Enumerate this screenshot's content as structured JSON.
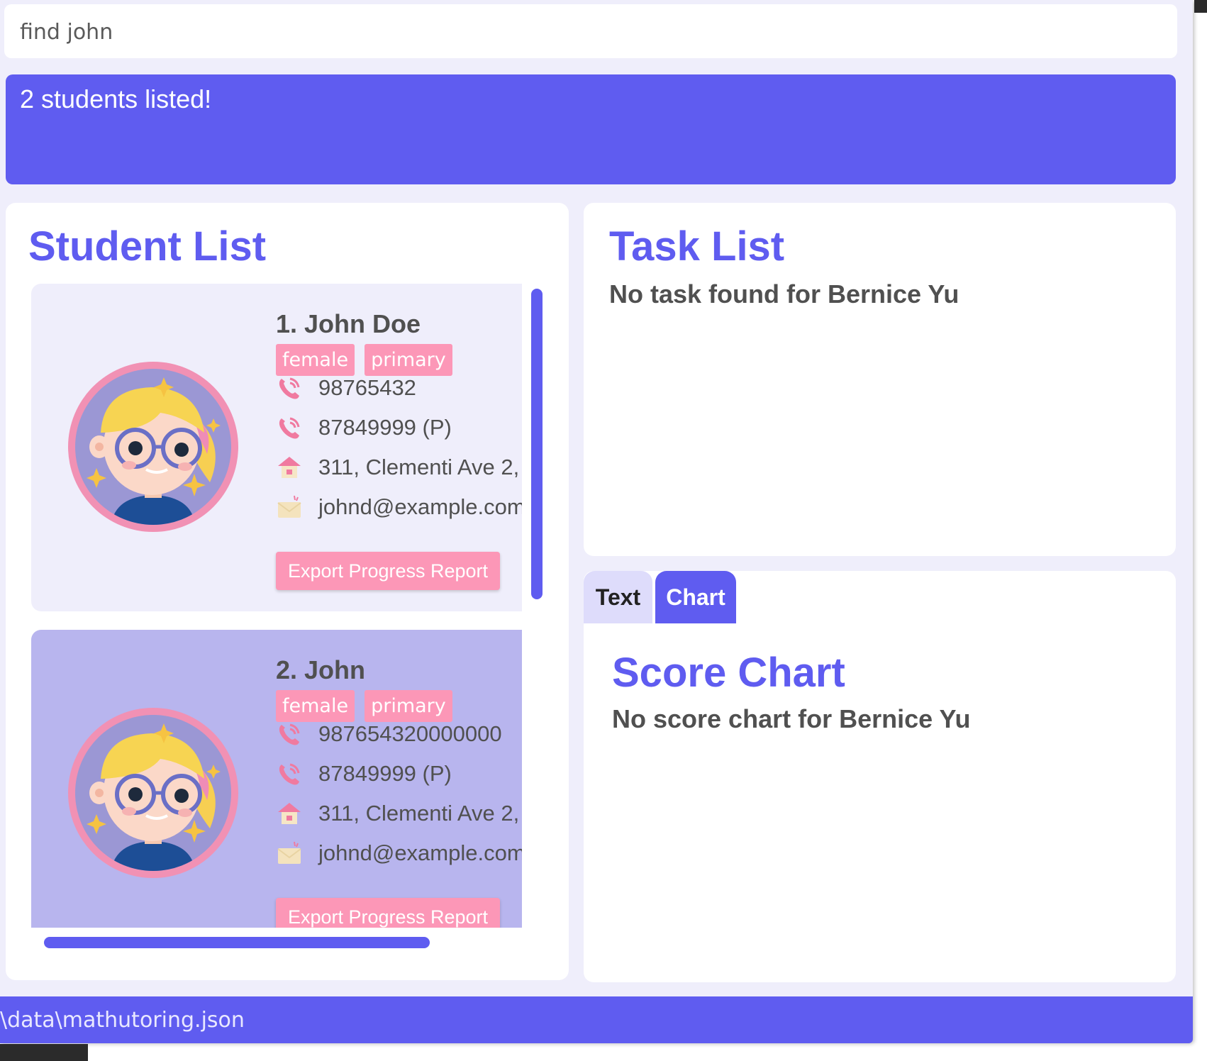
{
  "command_box": {
    "value": "find john"
  },
  "result_display": {
    "text": "2 students listed!"
  },
  "student_panel": {
    "title": "Student List",
    "students": [
      {
        "index_name": "1.  John Doe",
        "tags": [
          "female",
          "primary"
        ],
        "phone": "98765432",
        "parent_phone": "87849999 (P)",
        "address": "311, Clementi Ave 2,",
        "email": "johnd@example.com",
        "export_label": "Export Progress Report"
      },
      {
        "index_name": "2.  John",
        "tags": [
          "female",
          "primary"
        ],
        "phone": "987654320000000",
        "parent_phone": "87849999 (P)",
        "address": "311, Clementi Ave 2,",
        "email": "johnd@example.com",
        "export_label": "Export Progress Report"
      }
    ]
  },
  "task_panel": {
    "title": "Task List",
    "empty_message": "No task found for Bernice Yu"
  },
  "score_panel": {
    "tabs": [
      {
        "label": "Text",
        "active": false
      },
      {
        "label": "Chart",
        "active": true
      }
    ],
    "title": "Score Chart",
    "empty_message": "No score chart for Bernice Yu"
  },
  "status_bar": {
    "path": "\\data\\mathutoring.json"
  },
  "icons": {
    "phone": "phone-icon",
    "parent_phone": "phone-icon",
    "address": "house-icon",
    "email": "envelope-icon",
    "avatar": "girl-avatar-icon"
  },
  "colors": {
    "accent": "#5f5cf0",
    "tag": "#fc97b7",
    "card_selected": "#b8b5ee",
    "card_default": "#efeefb"
  }
}
